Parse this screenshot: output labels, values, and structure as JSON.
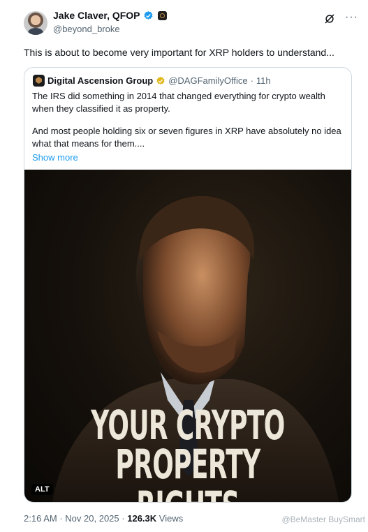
{
  "author": {
    "name": "Jake Claver, QFOP",
    "handle": "@beyond_broke"
  },
  "tweet": {
    "text": "This is about to become very important for XRP holders to understand..."
  },
  "quote": {
    "name": "Digital Ascension Group",
    "handle": "@DAGFamilyOffice",
    "separator": "·",
    "time": "11h",
    "paragraph1": "The IRS did something in 2014 that changed everything for crypto wealth when they classified it as property.",
    "paragraph2": "And most people holding six or seven figures in XRP have absolutely no idea what that means for them....",
    "show_more": "Show more",
    "media": {
      "headline_line1": "YOUR CRYPTO",
      "headline_line2": "PROPERTY RIGHTS",
      "alt_badge": "ALT"
    }
  },
  "meta": {
    "time": "2:16 AM",
    "date": "Nov 20, 2025",
    "separator": "·",
    "views_count": "126.3K",
    "views_label": "Views"
  },
  "watermark": "@BeMaster BuySmart",
  "colors": {
    "verified_blue": "#1d9bf0",
    "gold_badge": "#e2b719",
    "link": "#1d9bf0"
  },
  "icons": [
    "verified-icon",
    "affiliate-badge-icon",
    "grok-icon",
    "more-icon",
    "gold-verified-icon"
  ]
}
